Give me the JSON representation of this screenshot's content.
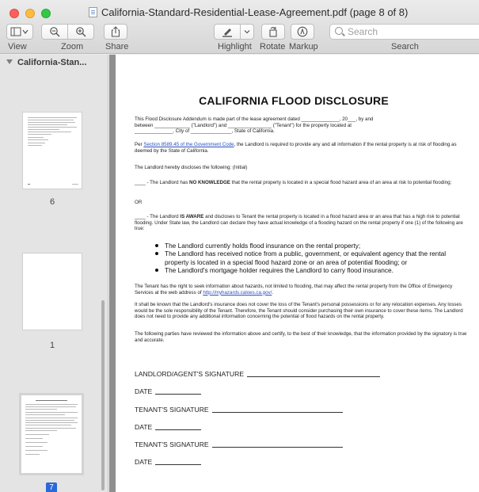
{
  "window": {
    "title": "California-Standard-Residential-Lease-Agreement.pdf (page 8 of 8)"
  },
  "toolbar": {
    "view_label": "View",
    "zoom_label": "Zoom",
    "share_label": "Share",
    "highlight_label": "Highlight",
    "rotate_label": "Rotate",
    "markup_label": "Markup",
    "search_label": "Search",
    "search_placeholder": "Search"
  },
  "sidebar": {
    "header": "California-Stan...",
    "pages": [
      {
        "number": "6",
        "selected": false
      },
      {
        "number": "1",
        "selected": false
      },
      {
        "number": "7",
        "selected": true
      }
    ]
  },
  "doc": {
    "title": "CALIFORNIA FLOOD DISCLOSURE",
    "p1a": "This Flood Disclosure Addendum is made part of the lease agreement dated ______________, 20___, by and",
    "p1b": "between _____________ (\"Landlord\") and ________________ (\"Tenant\") for the property located at",
    "p1c": "______________, City of _______________, State of California.",
    "p2_pre": "Per ",
    "p2_link": "Section 8589.45 of the Government Code",
    "p2_post": ", the Landlord is required to provide any and all information if the rental property is at risk of flooding as deemed by the State of California.",
    "p3": "The Landlord hereby discloses the following: (Initial)",
    "p4_pre": "____ - The Landlord has ",
    "p4_bold": "NO KNOWLEDGE",
    "p4_post": " that the rental property is located in a special flood hazard area of an area at risk to potential flooding;",
    "or": "OR",
    "p5_pre": "____ - The Landlord ",
    "p5_bold": "IS AWARE",
    "p5_post": " and discloses to Tenant the rental property is located in a flood hazard area or an area that has a high risk to potential flooding. Under State law, the Landlord can declare they have actual knowledge of a flooding hazard on the rental property if one (1) of the following are true:",
    "bullets": [
      "The Landlord currently holds flood insurance on the rental property;",
      "The Landlord has received notice from a public, government, or equivalent agency that the rental property is located in a special flood hazard zone or an area of potential flooding; or",
      "The Landlord's mortgage holder requires the Landlord to carry flood insurance."
    ],
    "p6_pre": "The Tenant has the right to seek information about hazards, not limited to flooding, that may affect the rental property from the Office of Emergency Services at the web address of ",
    "p6_link": "http://myhazards.caloes.ca.gov/",
    "p6_post": ".",
    "p7": "It shall be known that the Landlord's insurance does not cover the loss of the Tenant's personal possessions or for any relocation expenses. Any losses would be the sole responsibility of the Tenant. Therefore, the Tenant should consider purchasing their own insurance to cover these items. The Landlord does not need to provide any additional information concerning the potential of flood hazards on the rental property.",
    "p8": "The following parties have reviewed the information above and certify, to the best of their knowledge, that the information provided by the signatory is true and accurate.",
    "sig1": "LANDLORD/AGENT'S SIGNATURE",
    "date1": "DATE",
    "sig2": "TENANT'S SIGNATURE",
    "date2": "DATE",
    "sig3": "TENANT'S SIGNATURE",
    "date3": "DATE"
  },
  "colors": {
    "close": "#fc605c",
    "minimize": "#fdbc40",
    "maximize": "#34c84a",
    "selection": "#2b68d9",
    "link": "#2a4fc1"
  }
}
